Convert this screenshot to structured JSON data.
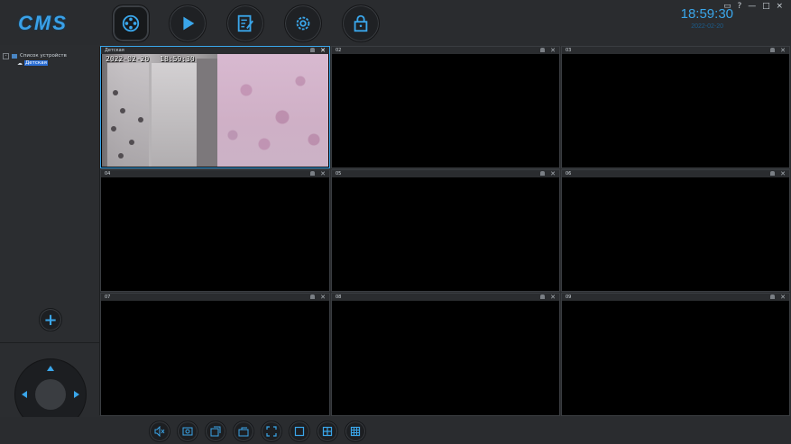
{
  "app": {
    "logo": "CMS"
  },
  "header": {
    "buttons": [
      {
        "name": "live-view",
        "icon": "film-reel-icon",
        "active": true
      },
      {
        "name": "playback",
        "icon": "play-icon",
        "active": false
      },
      {
        "name": "log",
        "icon": "notepad-icon",
        "active": false
      },
      {
        "name": "settings",
        "icon": "gear-icon",
        "active": false
      },
      {
        "name": "lock",
        "icon": "lock-icon",
        "active": false
      }
    ],
    "time": "18:59:30",
    "date": "2022-02-20",
    "window_controls": [
      "?",
      "—",
      "□",
      "×"
    ]
  },
  "sidebar": {
    "tree_root": "Список устройств",
    "tree_children": [
      "Детская"
    ],
    "add_label": "+"
  },
  "grid": {
    "cells": [
      {
        "index": 1,
        "title": "Детская",
        "has_video": true,
        "selected": true
      },
      {
        "index": 2,
        "title": "02",
        "has_video": false,
        "selected": false
      },
      {
        "index": 3,
        "title": "03",
        "has_video": false,
        "selected": false
      },
      {
        "index": 4,
        "title": "04",
        "has_video": false,
        "selected": false
      },
      {
        "index": 5,
        "title": "05",
        "has_video": false,
        "selected": false
      },
      {
        "index": 6,
        "title": "06",
        "has_video": false,
        "selected": false
      },
      {
        "index": 7,
        "title": "07",
        "has_video": false,
        "selected": false
      },
      {
        "index": 8,
        "title": "08",
        "has_video": false,
        "selected": false
      },
      {
        "index": 9,
        "title": "09",
        "has_video": false,
        "selected": false
      }
    ],
    "osd": {
      "date": "2022-02-20",
      "time": "18:59:30"
    }
  },
  "toolbar": {
    "buttons": [
      "mute-icon",
      "snapshot-icon",
      "record-icon",
      "export-icon",
      "fullscreen-icon",
      "layout-1-icon",
      "layout-4-icon",
      "layout-9-icon"
    ]
  },
  "colors": {
    "accent": "#3aa6ea",
    "panel": "#2b2d30",
    "cell_border": "#3a3d41"
  }
}
